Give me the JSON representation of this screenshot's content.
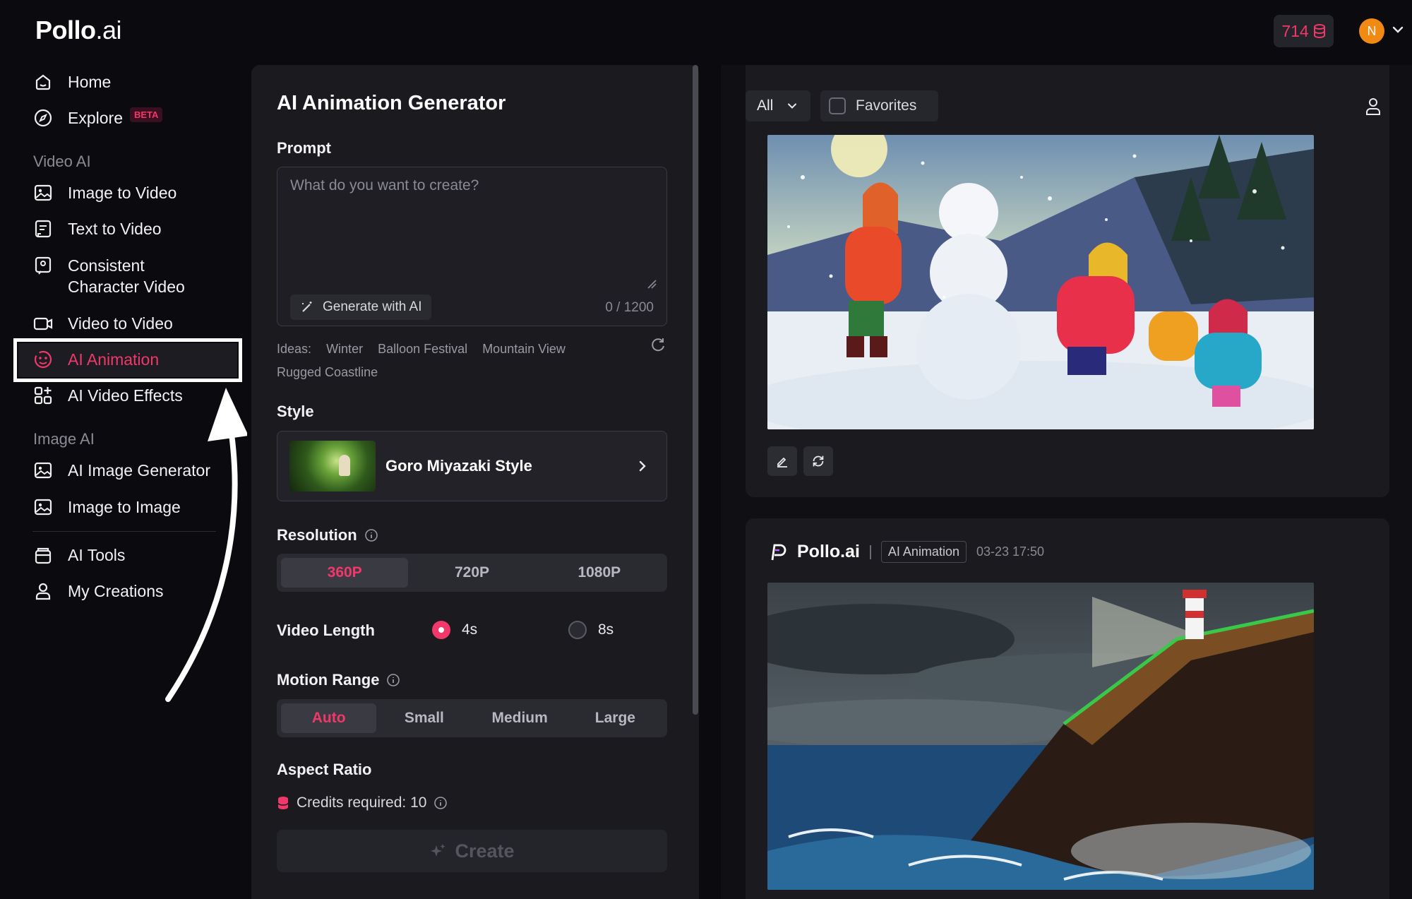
{
  "header": {
    "logo_main": "Pollo",
    "logo_tld": ".ai",
    "credits": "714",
    "avatar_initial": "N"
  },
  "sidebar": {
    "home": "Home",
    "explore": "Explore",
    "explore_badge": "BETA",
    "video_ai_label": "Video AI",
    "video_items": [
      "Image to Video",
      "Text to Video",
      "Consistent",
      "Character Video",
      "Video to Video",
      "AI Animation",
      "AI Video Effects"
    ],
    "image_ai_label": "Image AI",
    "image_items": [
      "AI Image Generator",
      "Image to Image"
    ],
    "ai_tools": "AI Tools",
    "my_creations": "My Creations",
    "active_item": "AI Animation"
  },
  "panel": {
    "title": "AI Animation Generator",
    "prompt_label": "Prompt",
    "prompt_placeholder": "What do you want to create?",
    "prompt_value": "",
    "generate_ai": "Generate with AI",
    "counter": "0 / 1200",
    "ideas_label": "Ideas:",
    "ideas": [
      "Winter",
      "Balloon Festival",
      "Mountain View",
      "Rugged Coastline"
    ],
    "style_label": "Style",
    "style_name": "Goro Miyazaki Style",
    "resolution_label": "Resolution",
    "resolutions": [
      "360P",
      "720P",
      "1080P"
    ],
    "resolution_selected": "360P",
    "video_length_label": "Video Length",
    "lengths": [
      "4s",
      "8s"
    ],
    "length_selected": "4s",
    "motion_label": "Motion Range",
    "motions": [
      "Auto",
      "Small",
      "Medium",
      "Large"
    ],
    "motion_selected": "Auto",
    "aspect_label": "Aspect Ratio",
    "credits_required": "Credits required: 10",
    "create_label": "Create"
  },
  "gallery": {
    "filter": "All",
    "favorites": "Favorites",
    "card2_brand": "Pollo.ai",
    "card2_tag": "AI Animation",
    "card2_time": "03-23 17:50"
  },
  "colors": {
    "accent": "#f0386a",
    "background": "#0b0b0f",
    "panel": "#1a1a1f"
  }
}
